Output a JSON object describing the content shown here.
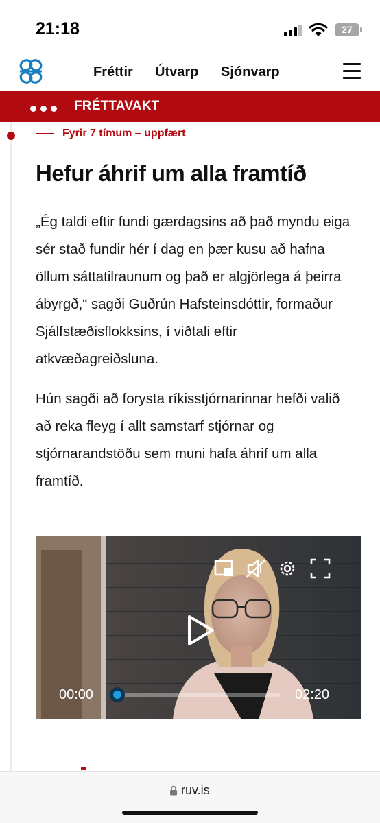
{
  "status_bar": {
    "time": "21:18",
    "battery": "27"
  },
  "header": {
    "logo_icon": "ruv-logo-icon",
    "nav": [
      {
        "label": "Fréttir"
      },
      {
        "label": "Útvarp"
      },
      {
        "label": "Sjónvarp"
      }
    ],
    "menu_icon": "hamburger-menu-icon"
  },
  "banner": {
    "label": "FRÉTTAVAKT",
    "color": "#b10b11"
  },
  "entry": {
    "meta": "Fyrir 7 tímum – uppfært",
    "title": "Hefur áhrif um alla framtíð",
    "paragraphs": [
      "„Ég taldi eftir fundi gærdagsins að það myndu eiga sér stað fundir hér í dag en þær kusu að hafna öllum sáttatilraunum og það er algjörlega á þeirra ábyrgð,“ sagði Guðrún Hafsteinsdóttir, formaður Sjálfstæðisflokksins, í viðtali eftir atkvæðagreiðsluna.",
      "Hún sagði að forysta ríkisstjórnarinnar hefði valið að reka fleyg í allt samstarf stjórnar og stjórnarandstöðu sem muni hafa áhrif um alla framtíð."
    ]
  },
  "video": {
    "current_time": "00:00",
    "duration": "02:20",
    "progress": 0,
    "controls": [
      "pip-icon",
      "audio-description-icon",
      "settings-icon",
      "fullscreen-icon"
    ],
    "accent": "#1a9fe0"
  },
  "browser": {
    "url": "ruv.is"
  }
}
